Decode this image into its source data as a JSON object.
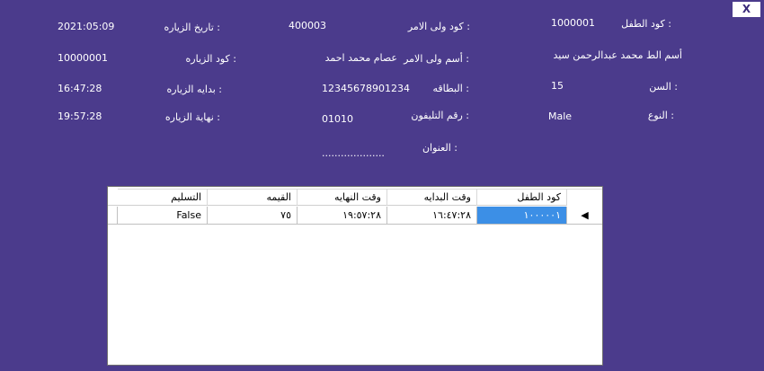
{
  "window": {
    "close_label": "X"
  },
  "fields": {
    "child_code": {
      "label": "كود الطفل",
      "value": "1000001"
    },
    "guardian_code": {
      "label": "كود ولى الامر",
      "value": "400003"
    },
    "visit_date": {
      "label": "تاريخ الزياره",
      "value": "2021:05:09"
    },
    "child_name": {
      "label": "أسم الط",
      "value": "محمد عبدالرحمن سيد"
    },
    "guardian_name": {
      "label": "أسم ولى الامر",
      "value": "عصام محمد احمد"
    },
    "visit_code": {
      "label": "كود الزياره",
      "value": "10000001"
    },
    "age": {
      "label": "السن",
      "value": "15"
    },
    "card": {
      "label": "البطاقه",
      "value": "12345678901234"
    },
    "visit_start": {
      "label": "بدايه الزياره",
      "value": "16:47:28"
    },
    "gender": {
      "label": "النوع",
      "value": "Male"
    },
    "phone": {
      "label": "رقم التليفون",
      "value": "01010"
    },
    "visit_end": {
      "label": "نهاية الزياره",
      "value": "19:57:28"
    },
    "address": {
      "label": "العنوان",
      "value": "...................."
    }
  },
  "grid": {
    "columns": [
      "كود الطفل",
      "وقت البدايه",
      "وقت النهايه",
      "القيمه",
      "التسليم"
    ],
    "rows": [
      {
        "indicator": "◀",
        "child_code": "١٠٠٠٠٠١",
        "start": "١٦:٤٧:٢٨",
        "end": "١٩:٥٧:٢٨",
        "value": "٧٥",
        "delivered": "False"
      }
    ]
  }
}
